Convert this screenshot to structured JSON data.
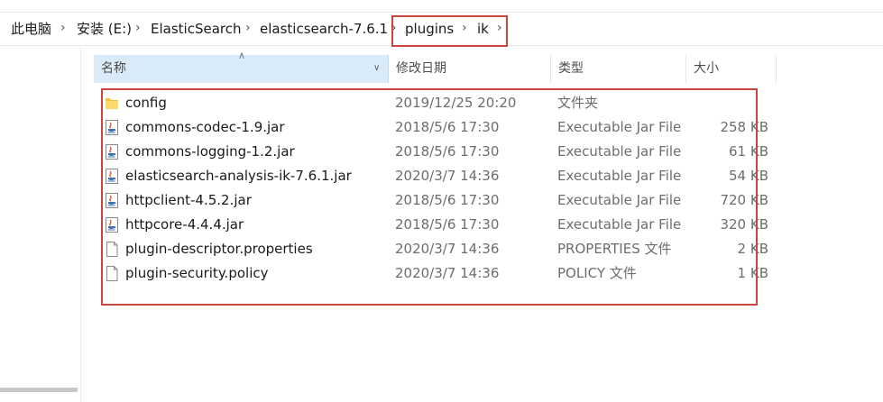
{
  "breadcrumb": [
    {
      "label": "此电脑"
    },
    {
      "label": "安装 (E:)"
    },
    {
      "label": "ElasticSearch"
    },
    {
      "label": "elasticsearch-7.6.1"
    },
    {
      "label": "plugins"
    },
    {
      "label": "ik"
    }
  ],
  "columns": {
    "name": "名称",
    "date": "修改日期",
    "type": "类型",
    "size": "大小"
  },
  "files": [
    {
      "name": "config",
      "date": "2019/12/25 20:20",
      "type": "文件夹",
      "size": "",
      "icon": "folder-icon"
    },
    {
      "name": "commons-codec-1.9.jar",
      "date": "2018/5/6 17:30",
      "type": "Executable Jar File",
      "size": "258 KB",
      "icon": "java-jar-icon"
    },
    {
      "name": "commons-logging-1.2.jar",
      "date": "2018/5/6 17:30",
      "type": "Executable Jar File",
      "size": "61 KB",
      "icon": "java-jar-icon"
    },
    {
      "name": "elasticsearch-analysis-ik-7.6.1.jar",
      "date": "2020/3/7 14:36",
      "type": "Executable Jar File",
      "size": "54 KB",
      "icon": "java-jar-icon"
    },
    {
      "name": "httpclient-4.5.2.jar",
      "date": "2018/5/6 17:30",
      "type": "Executable Jar File",
      "size": "720 KB",
      "icon": "java-jar-icon"
    },
    {
      "name": "httpcore-4.4.4.jar",
      "date": "2018/5/6 17:30",
      "type": "Executable Jar File",
      "size": "320 KB",
      "icon": "java-jar-icon"
    },
    {
      "name": "plugin-descriptor.properties",
      "date": "2020/3/7 14:36",
      "type": "PROPERTIES 文件",
      "size": "2 KB",
      "icon": "file-icon"
    },
    {
      "name": "plugin-security.policy",
      "date": "2020/3/7 14:36",
      "type": "POLICY 文件",
      "size": "1 KB",
      "icon": "file-icon"
    }
  ],
  "colors": {
    "highlight": "#c9453d",
    "header_selected": "#d9ebf9",
    "folder": "#f5c242"
  }
}
